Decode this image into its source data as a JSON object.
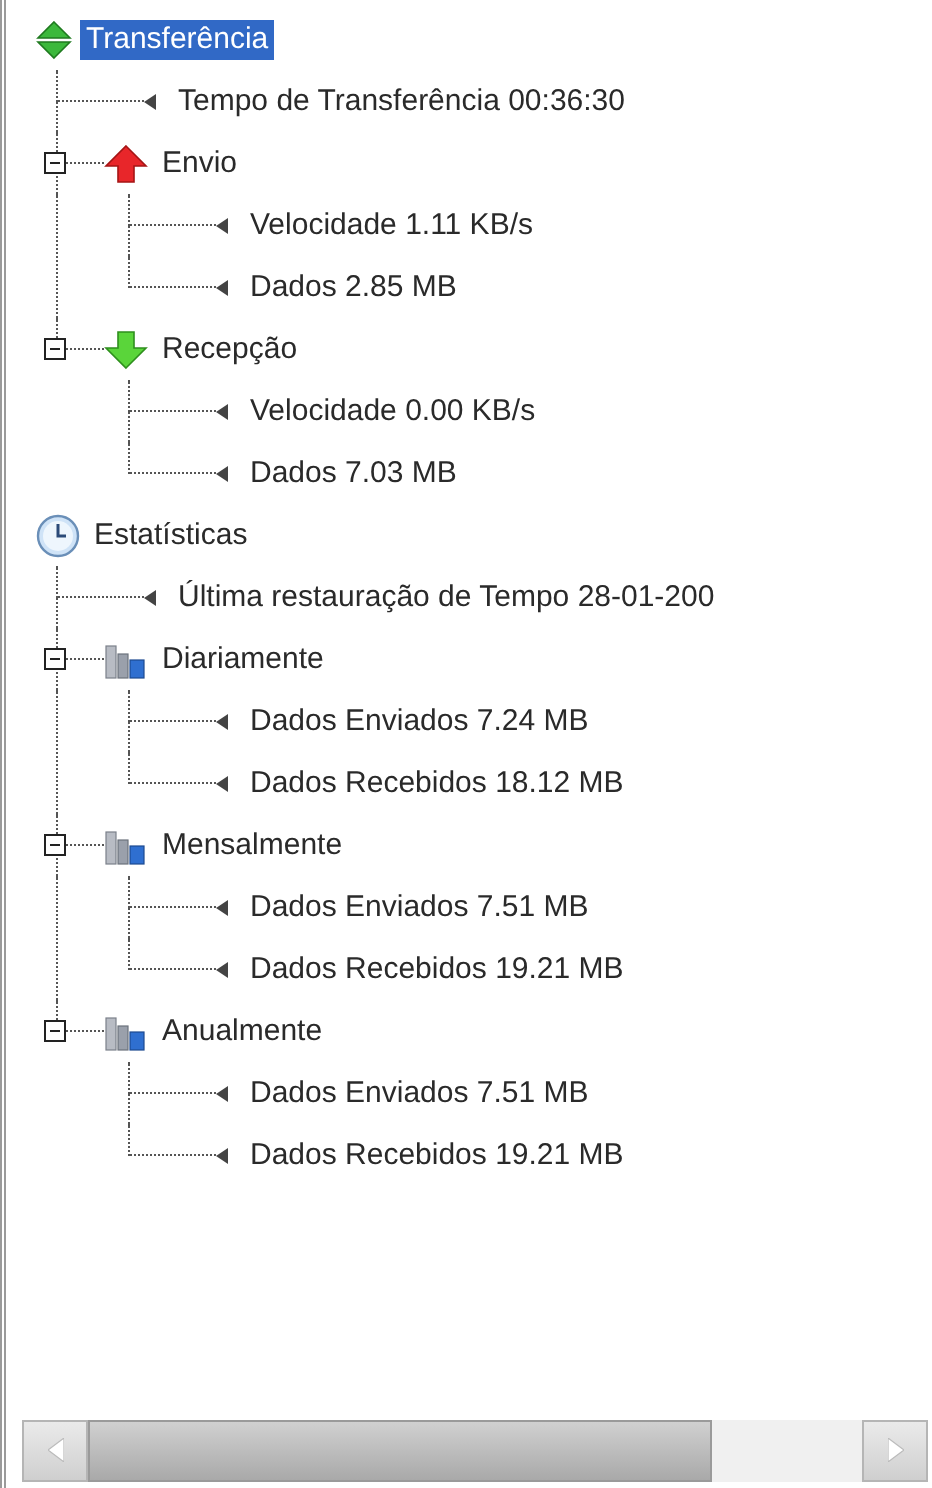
{
  "tree": [
    {
      "label": "Transferência",
      "kind": "updown",
      "selected": true,
      "children": [
        {
          "label": "Tempo de Transferência 00:36:30",
          "kind": "pointer",
          "selected": false
        },
        {
          "label": "Envio",
          "kind": "up",
          "selected": false,
          "expanded": true,
          "children": [
            {
              "label": "Velocidade 1.11 KB/s",
              "kind": "pointer",
              "selected": false
            },
            {
              "label": "Dados 2.85 MB",
              "kind": "pointer",
              "selected": false
            }
          ]
        },
        {
          "label": "Recepção",
          "kind": "down",
          "selected": false,
          "expanded": true,
          "children": [
            {
              "label": "Velocidade 0.00 KB/s",
              "kind": "pointer",
              "selected": false
            },
            {
              "label": "Dados 7.03 MB",
              "kind": "pointer",
              "selected": false
            }
          ]
        }
      ]
    },
    {
      "label": "Estatísticas",
      "kind": "clock",
      "selected": false,
      "children": [
        {
          "label": "Última restauração de Tempo 28-01-200",
          "kind": "pointer",
          "selected": false
        },
        {
          "label": "Diariamente",
          "kind": "chart",
          "selected": false,
          "expanded": true,
          "children": [
            {
              "label": "Dados Enviados 7.24 MB",
              "kind": "pointer",
              "selected": false
            },
            {
              "label": "Dados Recebidos 18.12 MB",
              "kind": "pointer",
              "selected": false
            }
          ]
        },
        {
          "label": "Mensalmente",
          "kind": "chart",
          "selected": false,
          "expanded": true,
          "children": [
            {
              "label": "Dados Enviados 7.51 MB",
              "kind": "pointer",
              "selected": false
            },
            {
              "label": "Dados Recebidos 19.21 MB",
              "kind": "pointer",
              "selected": false
            }
          ]
        },
        {
          "label": "Anualmente",
          "kind": "chart",
          "selected": false,
          "expanded": true,
          "children": [
            {
              "label": "Dados Enviados 7.51 MB",
              "kind": "pointer",
              "selected": false
            },
            {
              "label": "Dados Recebidos 19.21 MB",
              "kind": "pointer",
              "selected": false
            }
          ]
        }
      ]
    }
  ]
}
